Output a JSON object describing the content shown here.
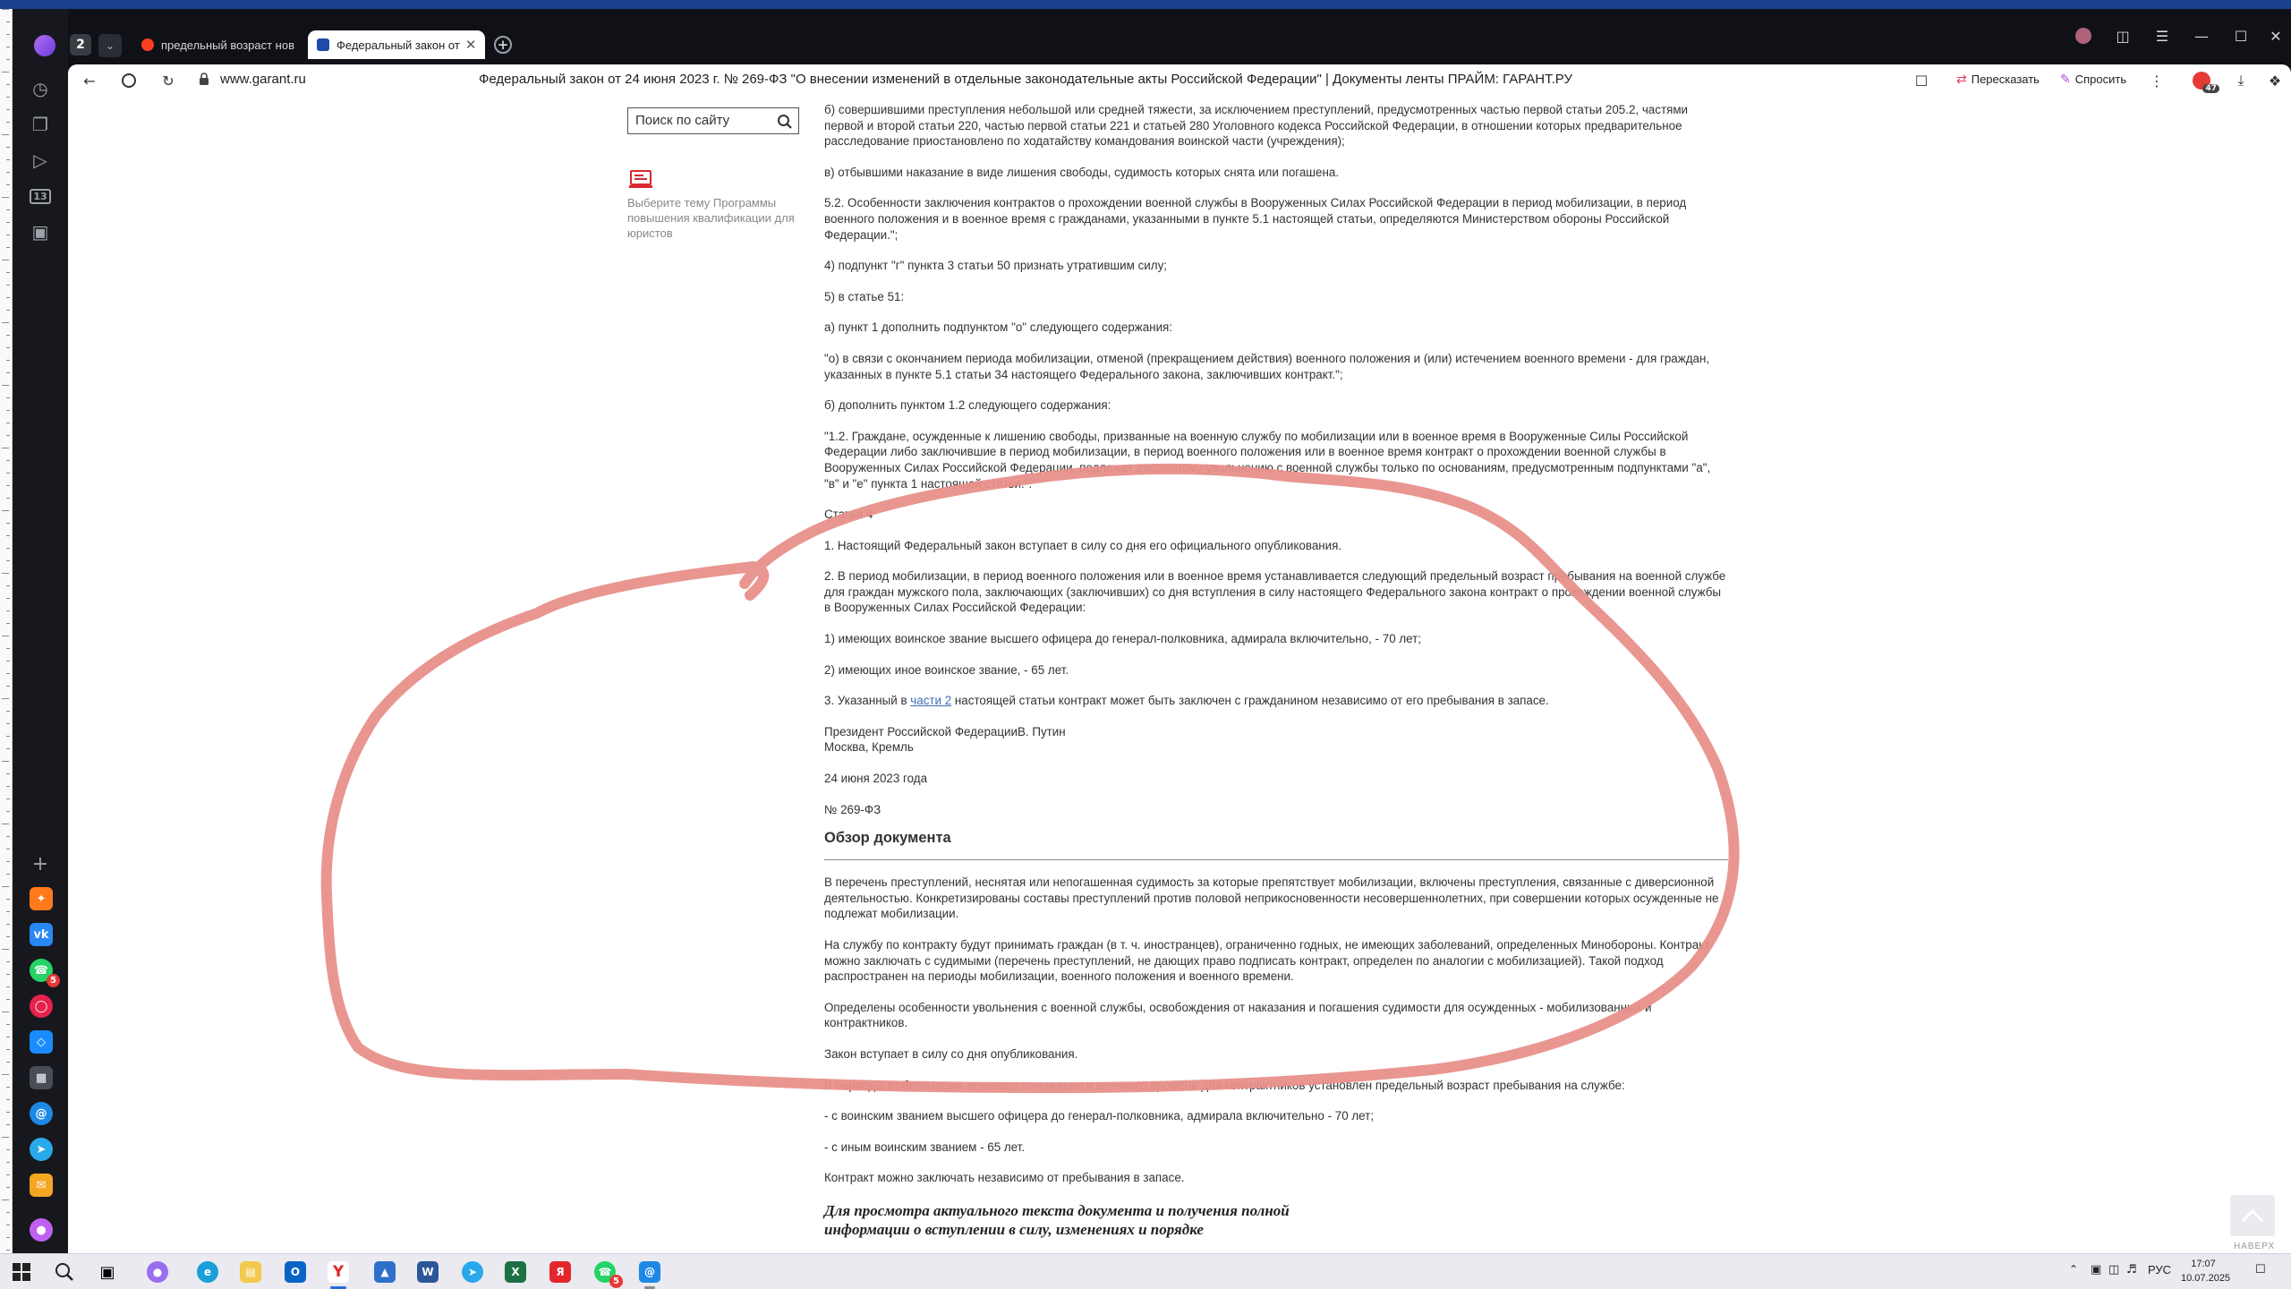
{
  "browser": {
    "tab_count": "2",
    "tabs": [
      {
        "title": "предельный возраст нов",
        "active": false
      },
      {
        "title": "Федеральный закон от",
        "active": true
      }
    ],
    "url_domain": "www.garant.ru",
    "page_heading": "Федеральный закон от 24 июня 2023 г. № 269-ФЗ \"О внесении изменений в отдельные законодательные акты Российской Федерации\" | Документы ленты ПРАЙМ: ГАРАНТ.РУ",
    "retell_label": "Пересказать",
    "ask_label": "Спросить",
    "sidebar_badge": "5",
    "ext_badge": "47"
  },
  "left_panel": {
    "search_placeholder": "Поиск по сайту",
    "promo_text": "Выберите тему Программы повышения квалификации для юристов"
  },
  "article": {
    "p1": "б) совершившими преступления небольшой или средней тяжести, за исключением преступлений, предусмотренных частью первой статьи 205.2, частями первой и второй статьи 220, частью первой статьи 221 и статьей 280 Уголовного кодекса Российской Федерации, в отношении которых предварительное расследование приостановлено по ходатайству командования воинской части (учреждения);",
    "p2": "в) отбывшими наказание в виде лишения свободы, судимость которых снята или погашена.",
    "p3": "5.2. Особенности заключения контрактов о прохождении военной службы в Вооруженных Силах Российской Федерации в период мобилизации, в период военного положения и в военное время с гражданами, указанными в пункте 5.1 настоящей статьи, определяются Министерством обороны Российской Федерации.\";",
    "p4": "4) подпункт \"г\" пункта 3 статьи 50 признать утратившим силу;",
    "p5": "5) в статье 51:",
    "p6": "а) пункт 1 дополнить подпунктом \"о\" следующего содержания:",
    "p7": "\"о) в связи с окончанием периода мобилизации, отменой (прекращением действия) военного положения и (или) истечением военного времени - для граждан, указанных в пункте 5.1 статьи 34 настоящего Федерального закона, заключивших контракт.\";",
    "p8": "б) дополнить пунктом 1.2 следующего содержания:",
    "p9": "\"1.2. Граждане, осужденные к лишению свободы, призванные на военную службу по мобилизации или в военное время в Вооруженные Силы Российской Федерации либо заключившие в период мобилизации, в период военного положения или в военное время контракт о прохождении военной службы в Вооруженных Силах Российской Федерации, подлежат досрочному увольнению с военной службы только по основаниям, предусмотренным подпунктами \"а\", \"в\" и \"е\" пункта 1 настоящей статьи.\".",
    "p10": "Статья 4",
    "p11": "1. Настоящий Федеральный закон вступает в силу со дня его официального опубликования.",
    "p12": "2. В период мобилизации, в период военного положения или в военное время устанавливается следующий предельный возраст пребывания на военной службе для граждан мужского пола, заключающих (заключивших) со дня вступления в силу настоящего Федерального закона контракт о прохождении военной службы в Вооруженных Силах Российской Федерации:",
    "p13": "1) имеющих воинское звание высшего офицера до генерал-полковника, адмирала включительно, - 70 лет;",
    "p14": "2) имеющих иное воинское звание, - 65 лет.",
    "p15_pre": "3. Указанный в ",
    "p15_link": "части 2",
    "p15_post": " настоящей статьи контракт может быть заключен с гражданином независимо от его пребывания в запасе.",
    "signer": "Президент Российской Федерации",
    "signer_name": "В. Путин",
    "place": "Москва, Кремль",
    "date": "24 июня 2023 года",
    "number": "№ 269-ФЗ",
    "review_title": "Обзор документа",
    "r1": "В перечень преступлений, неснятая или непогашенная судимость за которые препятствует мобилизации, включены преступления, связанные с диверсионной деятельностью. Конкретизированы составы преступлений против половой неприкосновенности несовершеннолетних, при совершении которых осужденные не подлежат мобилизации.",
    "r2": "На службу по контракту будут принимать граждан (в т. ч. иностранцев), ограниченно годных, не имеющих заболеваний, определенных Минобороны. Контракт можно заключать с судимыми (перечень преступлений, не дающих право подписать контракт, определен по аналогии с мобилизацией). Такой подход распространен на периоды мобилизации, военного положения и военного времени.",
    "r3": "Определены особенности увольнения с военной службы, освобождения от наказания и погашения судимости для осужденных - мобилизованных и контрактников.",
    "r4": "Закон вступает в силу со дня опубликования.",
    "r5": "В периоды мобилизации, военного положения и военного времени для контрактников установлен предельный возраст пребывания на службе:",
    "r6": "- с воинским званием высшего офицера до генерал-полковника, адмирала включительно - 70 лет;",
    "r7": "- с иным воинским званием - 65 лет.",
    "r8": "Контракт можно заключать независимо от пребывания в запасе.",
    "cta": "Для просмотра актуального текста документа и получения полной информации о вступлении в силу, изменениях и порядке"
  },
  "back_to_top_label": "НАВЕРХ",
  "taskbar": {
    "whatsapp_badge": "5",
    "lang": "РУС",
    "time": "17:07",
    "date": "10.07.2025"
  },
  "colors": {
    "annotation_stroke": "#e8908a",
    "chrome_bg": "#0f1117",
    "link": "#3a6fb3"
  }
}
